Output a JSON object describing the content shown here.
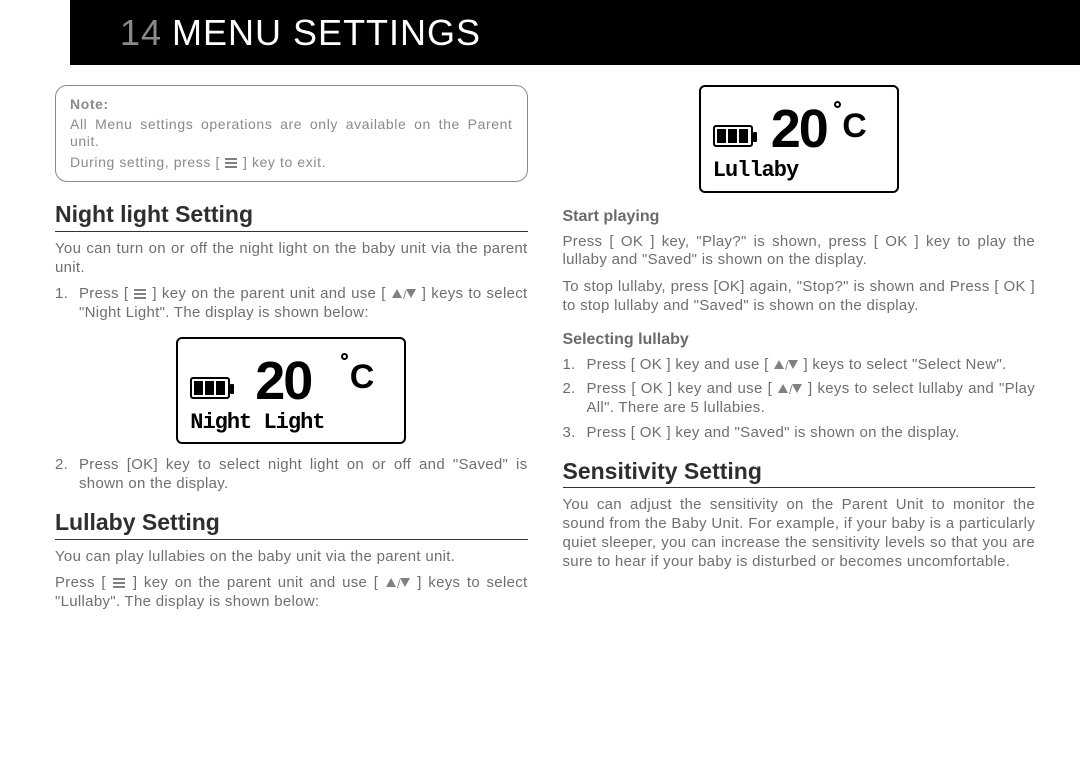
{
  "header": {
    "pageNumber": "14",
    "title": "MENU SETTINGS"
  },
  "note": {
    "label": "Note:",
    "line1": "All Menu settings operations are only available on the Parent unit.",
    "line2_a": "During setting, press [ ",
    "line2_b": " ] key to exit."
  },
  "lcd1": {
    "temp": "20",
    "unit": "C",
    "label": "Night Light"
  },
  "lcd2": {
    "temp": "20",
    "unit": "C",
    "label": "Lullaby"
  },
  "night": {
    "heading": "Night light Setting",
    "intro": "You can turn on or off the night light on the baby unit via the parent unit.",
    "s1a": "Press [ ",
    "s1b": " ] key on the parent unit and use [ ",
    "s1c": " ] keys to select \"Night Light\". The display is shown below:",
    "s2": "Press [OK] key to select night light on or off and \"Saved\" is shown on the display."
  },
  "lull": {
    "heading": "Lullaby Setting",
    "intro": "You can play lullabies on the baby unit via the parent unit.",
    "p1a": "Press [ ",
    "p1b": " ] key on the parent unit and use [ ",
    "p1c": " ] keys to select \"Lullaby\". The display is shown below:",
    "start": {
      "heading": "Start playing",
      "p1": "Press [ OK ] key, \"Play?\" is shown, press [ OK ] key to play the lullaby and \"Saved\" is shown on the display.",
      "p2": "To stop lullaby, press [OK] again, \"Stop?\" is shown and Press [ OK ] to stop lullaby and \"Saved\" is shown on the display."
    },
    "sel": {
      "heading": "Selecting lullaby",
      "s1a": "Press [ OK ] key and use [ ",
      "s1b": " ] keys to select \"Select New\".",
      "s2a": "Press [ OK ] key and use [ ",
      "s2b": " ] keys to select lullaby and \"Play All\". There are 5 lullabies.",
      "s3": "Press [ OK ] key and \"Saved\" is shown on the display."
    }
  },
  "sens": {
    "heading": "Sensitivity Setting",
    "intro": "You can adjust the sensitivity on the Parent Unit to monitor the sound from the Baby Unit. For example, if your baby is a particularly quiet sleeper, you can increase the sensitivity levels so that you are sure to hear if your baby is disturbed or becomes uncomfortable."
  }
}
